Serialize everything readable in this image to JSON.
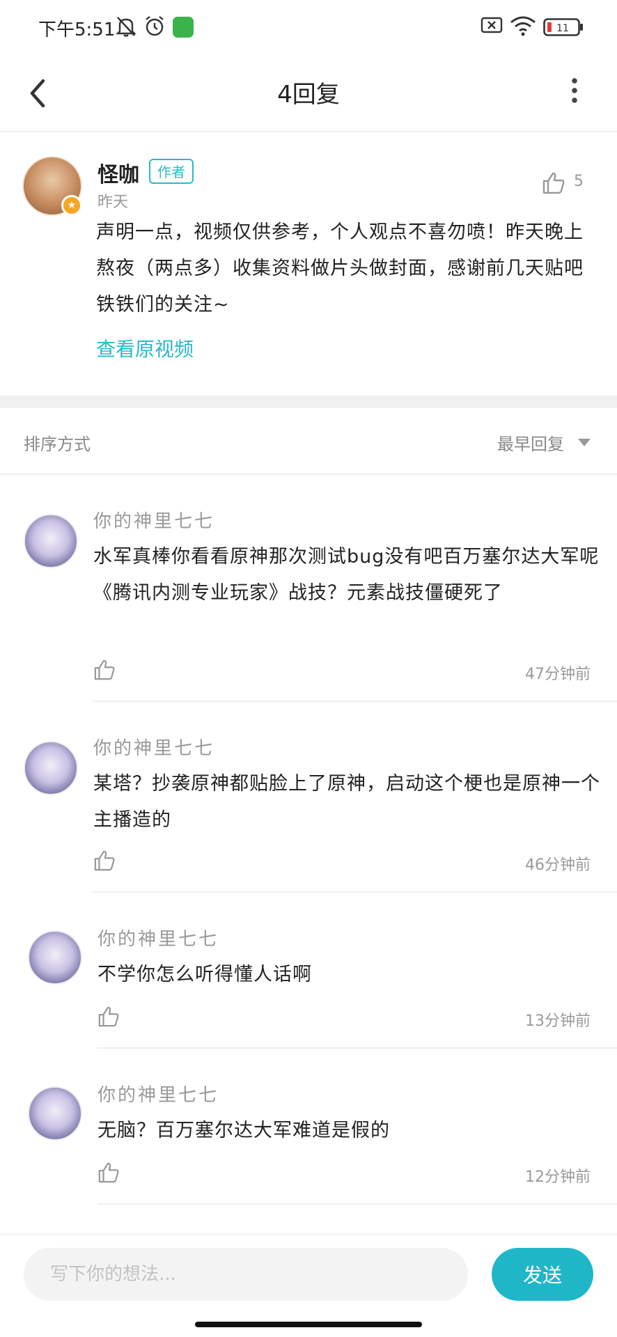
{
  "status_bar": {
    "time": "下午5:51",
    "icons": [
      "bell-mute-icon",
      "alarm-icon",
      "app-icon",
      "sim-off-icon",
      "wifi-icon",
      "battery-icon"
    ],
    "battery_level": 0.11
  },
  "nav": {
    "title": "4回复",
    "back_icon": "chevron-left-icon",
    "more_icon": "more-vertical-icon"
  },
  "post": {
    "author": "怪咖",
    "author_tag": "作者",
    "time": "昨天",
    "like_count": "5",
    "text": "声明一点，视频仅供参考，个人观点不喜勿喷！昨天晚上熬夜（两点多）收集资料做片头做封面，感谢前几天贴吧铁铁们的关注~",
    "view_video": "查看原视频"
  },
  "sort": {
    "label": "排序方式",
    "value": "最早回复"
  },
  "replies": [
    {
      "name": "你的神里七七",
      "text": "水军真棒你看看原神那次测试bug没有吧百万塞尔达大军呢《腾讯内测专业玩家》战技？元素战技僵硬死了",
      "time": "47分钟前"
    },
    {
      "name": "你的神里七七",
      "text": "某塔？抄袭原神都贴脸上了原神，启动这个梗也是原神一个主播造的",
      "time": "46分钟前"
    },
    {
      "name": "你的神里七七",
      "text": "不学你怎么听得懂人话啊",
      "time": "13分钟前"
    },
    {
      "name": "你的神里七七",
      "text": "无脑？百万塞尔达大军难道是假的",
      "time": "12分钟前"
    }
  ],
  "bottom_bar": {
    "input_placeholder": "写下你的想法...",
    "send_label": "发送"
  },
  "colors": {
    "accent": "#1fb7c8",
    "tag": "#2ab8c8",
    "badge": "#f5a623"
  }
}
